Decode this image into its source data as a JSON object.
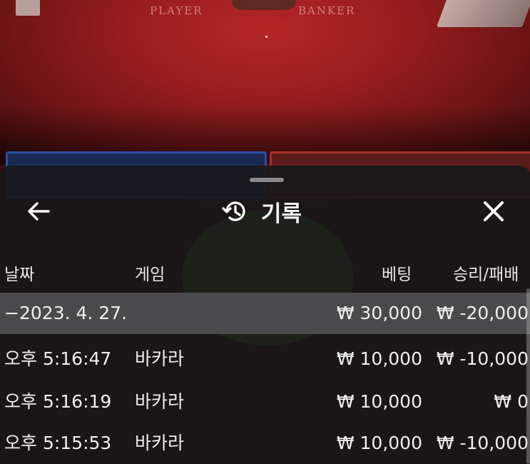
{
  "table": {
    "player_label": "PLAYER",
    "banker_label": "BANKER"
  },
  "panel": {
    "title": "기록",
    "icons": {
      "back": "arrow-left-icon",
      "history": "history-clock-icon",
      "close": "close-x-icon"
    },
    "columns": {
      "date": "날짜",
      "game": "게임",
      "bet": "베팅",
      "win_loss": "승리/패배"
    },
    "summary": {
      "date": "−2023. 4. 27.",
      "bet": "₩ 30,000",
      "win_loss": "₩ -20,000"
    },
    "rows": [
      {
        "time": "오후 5:16:47",
        "game": "바카라",
        "bet": "₩ 10,000",
        "win_loss": "₩ -10,000"
      },
      {
        "time": "오후 5:16:19",
        "game": "바카라",
        "bet": "₩ 10,000",
        "win_loss": "₩ 0"
      },
      {
        "time": "오후 5:15:53",
        "game": "바카라",
        "bet": "₩ 10,000",
        "win_loss": "₩ -10,000"
      }
    ]
  },
  "colors": {
    "panel_bg": "#18181a",
    "summary_row_bg": "#4a4a4c",
    "table_felt": "#9a1e1e",
    "player_box": "#2b4ca8",
    "banker_box": "#a8302b"
  }
}
